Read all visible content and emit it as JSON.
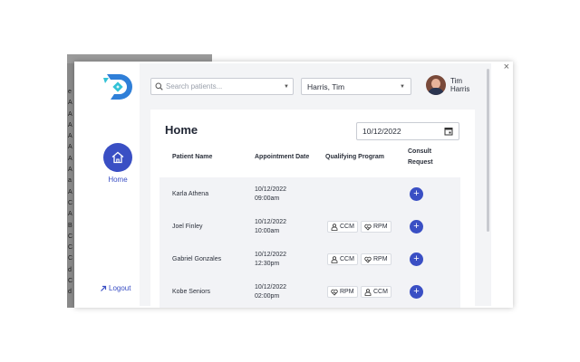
{
  "background_letters": [
    "e",
    "A",
    "A",
    "A",
    "A",
    "A",
    "A",
    "A",
    "a",
    "A",
    "C",
    "A",
    "B",
    "C",
    "C",
    "C",
    "d",
    "C",
    "d"
  ],
  "popup": {
    "close_label": "×"
  },
  "sidebar": {
    "home_label": "Home",
    "logout_label": "Logout",
    "accent_color": "#3a4fc4"
  },
  "header": {
    "search_placeholder": "Search patients...",
    "provider_select": "Harris, Tim",
    "user_name": "Tim Harris"
  },
  "home": {
    "title": "Home",
    "date": "10/12/2022",
    "columns": {
      "patient_name": "Patient Name",
      "appointment_date": "Appointment Date",
      "qualifying_program": "Qualifying Program",
      "consult_request": "Consult Request"
    },
    "rows": [
      {
        "name": "Karla Athena",
        "date": "10/12/2022",
        "time": "09:00am",
        "programs": []
      },
      {
        "name": "Joel Finley",
        "date": "10/12/2022",
        "time": "10:00am",
        "programs": [
          "CCM",
          "RPM"
        ]
      },
      {
        "name": "Gabriel Gonzales",
        "date": "10/12/2022",
        "time": "12:30pm",
        "programs": [
          "CCM",
          "RPM"
        ]
      },
      {
        "name": "Kobe Seniors",
        "date": "10/12/2022",
        "time": "02:00pm",
        "programs": [
          "RPM",
          "CCM"
        ]
      }
    ],
    "add_label": "+"
  }
}
